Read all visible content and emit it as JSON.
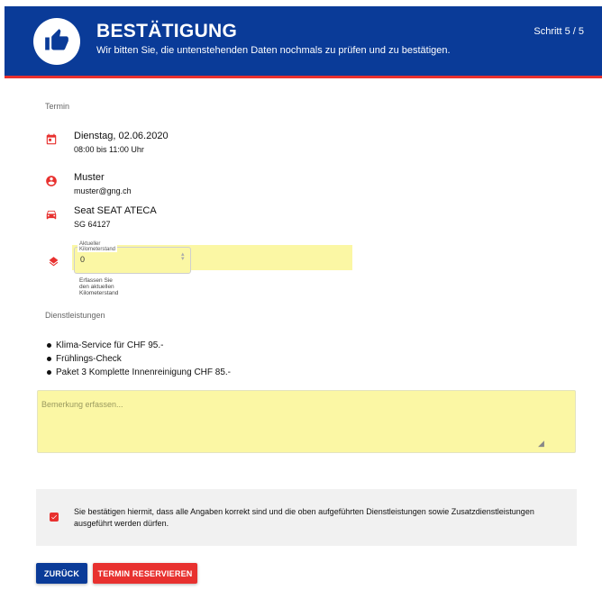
{
  "header": {
    "title": "BESTÄTIGUNG",
    "subtitle": "Wir bitten Sie, die untenstehenden Daten nochmals zu prüfen und zu bestätigen.",
    "step": "Schritt 5 / 5"
  },
  "termin": {
    "section_label": "Termin",
    "date": "Dienstag, 02.06.2020",
    "time": "08:00 bis 11:00 Uhr",
    "name": "Muster",
    "email": "muster@gng.ch",
    "car": "Seat SEAT ATECA",
    "plate": "SG 64127"
  },
  "km": {
    "label": "Aktueller Kilometerstand",
    "value": "0",
    "hint": "Erfassen Sie den aktuellen Kilometerstand"
  },
  "services": {
    "section_label": "Dienstleistungen",
    "items": [
      "Klima-Service für CHF 95.-",
      "Frühlings-Check",
      "Paket 3 Komplette Innenreinigung CHF 85.-"
    ]
  },
  "remark": {
    "placeholder": "Bemerkung erfassen..."
  },
  "confirm": {
    "checked": true,
    "text": "Sie bestätigen hiermit, dass alle Angaben korrekt sind und die oben aufgeführten Dienstleistungen sowie Zusatzdienstleistungen ausgeführt werden dürfen."
  },
  "buttons": {
    "back": "ZURÜCK",
    "reserve": "TERMIN RESERVIEREN"
  },
  "colors": {
    "primary": "#0a3b98",
    "accent": "#e8312f",
    "highlight": "#fbf7a4"
  },
  "icons": [
    "thumbs-up-icon",
    "calendar-icon",
    "user-circle-icon",
    "car-icon",
    "layers-icon",
    "check-icon"
  ]
}
